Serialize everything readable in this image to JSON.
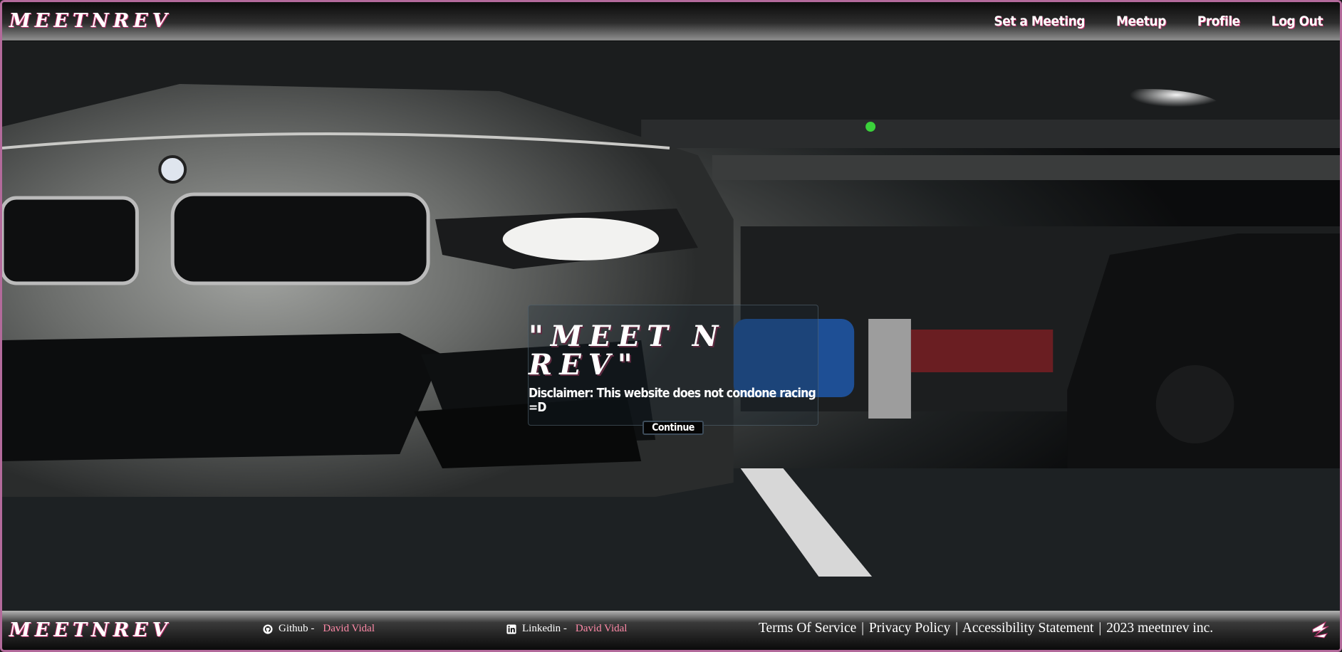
{
  "header": {
    "brand": "MEETNREV",
    "nav": [
      "Set a Meeting",
      "Meetup",
      "Profile",
      "Log Out"
    ]
  },
  "modal": {
    "title": "\"MEET N REV\"",
    "disclaimer": "Disclaimer: This website does not condone racing =D",
    "continue_label": "Continue"
  },
  "footer": {
    "brand": "MEETNREV",
    "github": {
      "label": "Github -",
      "name": "David Vidal",
      "icon": "github-icon"
    },
    "linkedin": {
      "label": "Linkedin -",
      "name": "David Vidal",
      "icon": "linkedin-icon"
    },
    "legal": {
      "terms": "Terms Of Service",
      "privacy": "Privacy Policy",
      "accessibility": "Accessibility Statement",
      "copyright": "2023 meetnrev inc."
    }
  },
  "colors": {
    "accent": "#b8306a",
    "link": "#ff8aa8",
    "frame": "#b36a9b"
  }
}
